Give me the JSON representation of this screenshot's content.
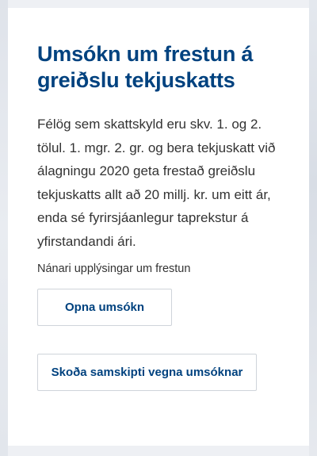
{
  "card": {
    "title": "Umsókn um frestun á greiðslu tekjuskatts",
    "body": "Félög sem skattskyld eru skv. 1. og 2. tölul. 1. mgr. 2. gr. og bera tekjuskatt við álagningu 2020 geta frestað greiðslu tekjuskatts allt að 20 millj. kr. um eitt ár, enda sé fyrirsjáanlegur taprekstur á yfirstandandi ári.",
    "more_info": "Nánari upplýsingar um frestun",
    "open_button_label": "Opna umsókn",
    "view_button_label": "Skoða samskipti vegna umsóknar"
  },
  "colors": {
    "title": "#00427f",
    "button_text": "#00427f",
    "body_text": "#333333",
    "background": "#eef0f4",
    "card": "#ffffff"
  }
}
